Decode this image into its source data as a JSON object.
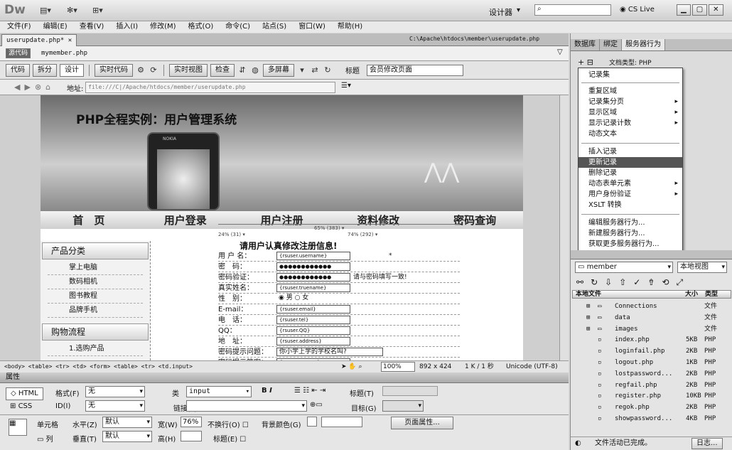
{
  "app": {
    "logo": "Dw",
    "workspace": "设计器",
    "search_placeholder": "",
    "cslive": "CS Live"
  },
  "menu": [
    "文件(F)",
    "编辑(E)",
    "查看(V)",
    "插入(I)",
    "修改(M)",
    "格式(O)",
    "命令(C)",
    "站点(S)",
    "窗口(W)",
    "帮助(H)"
  ],
  "doc": {
    "tab": "userupdate.php*",
    "path": "C:\\Apache\\htdocs\\member\\userupdate.php",
    "source_tag": "源代码",
    "related": "mymember.php"
  },
  "toolbar": {
    "code": "代码",
    "split": "拆分",
    "design": "设计",
    "live_code": "实时代码",
    "live_view": "实时视图",
    "inspect": "检查",
    "multiscreen": "多屏幕",
    "title_label": "标题",
    "title_value": "会员修改页面"
  },
  "address": {
    "label": "地址:",
    "value": "file:///C|/Apache/htdocs/member/userupdate.php"
  },
  "page": {
    "banner_title": "PHP全程实例：用户管理系统",
    "phone_brand": "NOKIA",
    "nav": [
      "首　页",
      "用户登录",
      "用户注册",
      "资料修改",
      "密码查询"
    ],
    "widths": {
      "w1": "24% (31) ▾",
      "w2": "65% (383) ▾",
      "w3": "74% (292) ▾"
    },
    "side_cat": "产品分类",
    "side_items": [
      "掌上电脑",
      "数码相机",
      "图书教程",
      "品牌手机"
    ],
    "side_flow": "购物流程",
    "side_flow_item": "1.选购产品",
    "form_title": "请用户认真修改注册信息!",
    "form": [
      {
        "label": "用 户 名：",
        "value": "{rsuser.username}",
        "extra": "*"
      },
      {
        "label": "密　码：",
        "value": "●●●●●●●●●●●●",
        "extra": ""
      },
      {
        "label": "密码验证：",
        "value": "●●●●●●●●●●●●",
        "extra": "请与密码填写一致!"
      },
      {
        "label": "真实姓名：",
        "value": "{rsuser.truename}",
        "extra": ""
      },
      {
        "label": "性　别：",
        "value": "◉ 男 ○ 女",
        "extra": ""
      },
      {
        "label": "E-mail：",
        "value": "{rsuser.email}",
        "extra": ""
      },
      {
        "label": "电　话：",
        "value": "{rsuser.tel}",
        "extra": ""
      },
      {
        "label": "QQ：",
        "value": "{rsuser.QQ}",
        "extra": ""
      },
      {
        "label": "地　址：",
        "value": "{rsuser.address}",
        "extra": ""
      },
      {
        "label": "密码提示问题：",
        "value": "你小学上学的学校名叫?",
        "extra": ""
      },
      {
        "label": "密码提示答案：",
        "value": "{rsuser.answer}",
        "extra": ""
      }
    ]
  },
  "status": {
    "tags": "<body> <table> <tr> <td> <form> <table> <tr> <td.input>",
    "zoom": "100%",
    "size": "892 x 424",
    "kb": "1 K / 1 秒",
    "encoding": "Unicode (UTF-8)"
  },
  "props": {
    "header": "属性",
    "html": "HTML",
    "css": "CSS",
    "format_label": "格式(F)",
    "format_val": "无",
    "class_label": "类",
    "class_val": "input",
    "id_label": "ID(I)",
    "id_val": "无",
    "link_label": "链接(L)",
    "title_label": "标题(T)",
    "target_label": "目标(G)",
    "cell_label": "单元格",
    "h_label": "水平(Z)",
    "h_val": "默认",
    "v_label": "垂直(T)",
    "v_val": "默认",
    "w_label": "宽(W)",
    "w_val": "76%",
    "hh_label": "高(H)",
    "nowrap_label": "不换行(O)",
    "header_label": "标题(E)",
    "bg_label": "背景颜色(G)",
    "page_props": "页面属性...",
    "col_label": "列"
  },
  "panel": {
    "tabs": [
      "数据库",
      "绑定",
      "服务器行为"
    ],
    "doc_type": "文档类型: PHP",
    "menu_items": [
      "记录集",
      "重复区域",
      "记录集分页",
      "显示区域",
      "显示记录计数",
      "动态文本",
      "插入记录",
      "更新记录",
      "删除记录",
      "动态表单元素",
      "用户身份验证",
      "XSLT 转换",
      "编辑服务器行为...",
      "新建服务器行为...",
      "获取更多服务器行为..."
    ]
  },
  "files": {
    "site": "member",
    "view": "本地视图",
    "col_name": "本地文件",
    "col_size": "大小",
    "col_type": "类型",
    "rows": [
      {
        "name": "Connections",
        "size": "",
        "type": "文件"
      },
      {
        "name": "data",
        "size": "",
        "type": "文件"
      },
      {
        "name": "images",
        "size": "",
        "type": "文件"
      },
      {
        "name": "index.php",
        "size": "5KB",
        "type": "PHP"
      },
      {
        "name": "loginfail.php",
        "size": "2KB",
        "type": "PHP"
      },
      {
        "name": "logout.php",
        "size": "1KB",
        "type": "PHP"
      },
      {
        "name": "lostpassword...",
        "size": "2KB",
        "type": "PHP"
      },
      {
        "name": "regfail.php",
        "size": "2KB",
        "type": "PHP"
      },
      {
        "name": "register.php",
        "size": "10KB",
        "type": "PHP"
      },
      {
        "name": "regok.php",
        "size": "2KB",
        "type": "PHP"
      },
      {
        "name": "showpassword...",
        "size": "4KB",
        "type": "PHP"
      }
    ],
    "status": "文件活动已完成。",
    "log": "日志..."
  }
}
